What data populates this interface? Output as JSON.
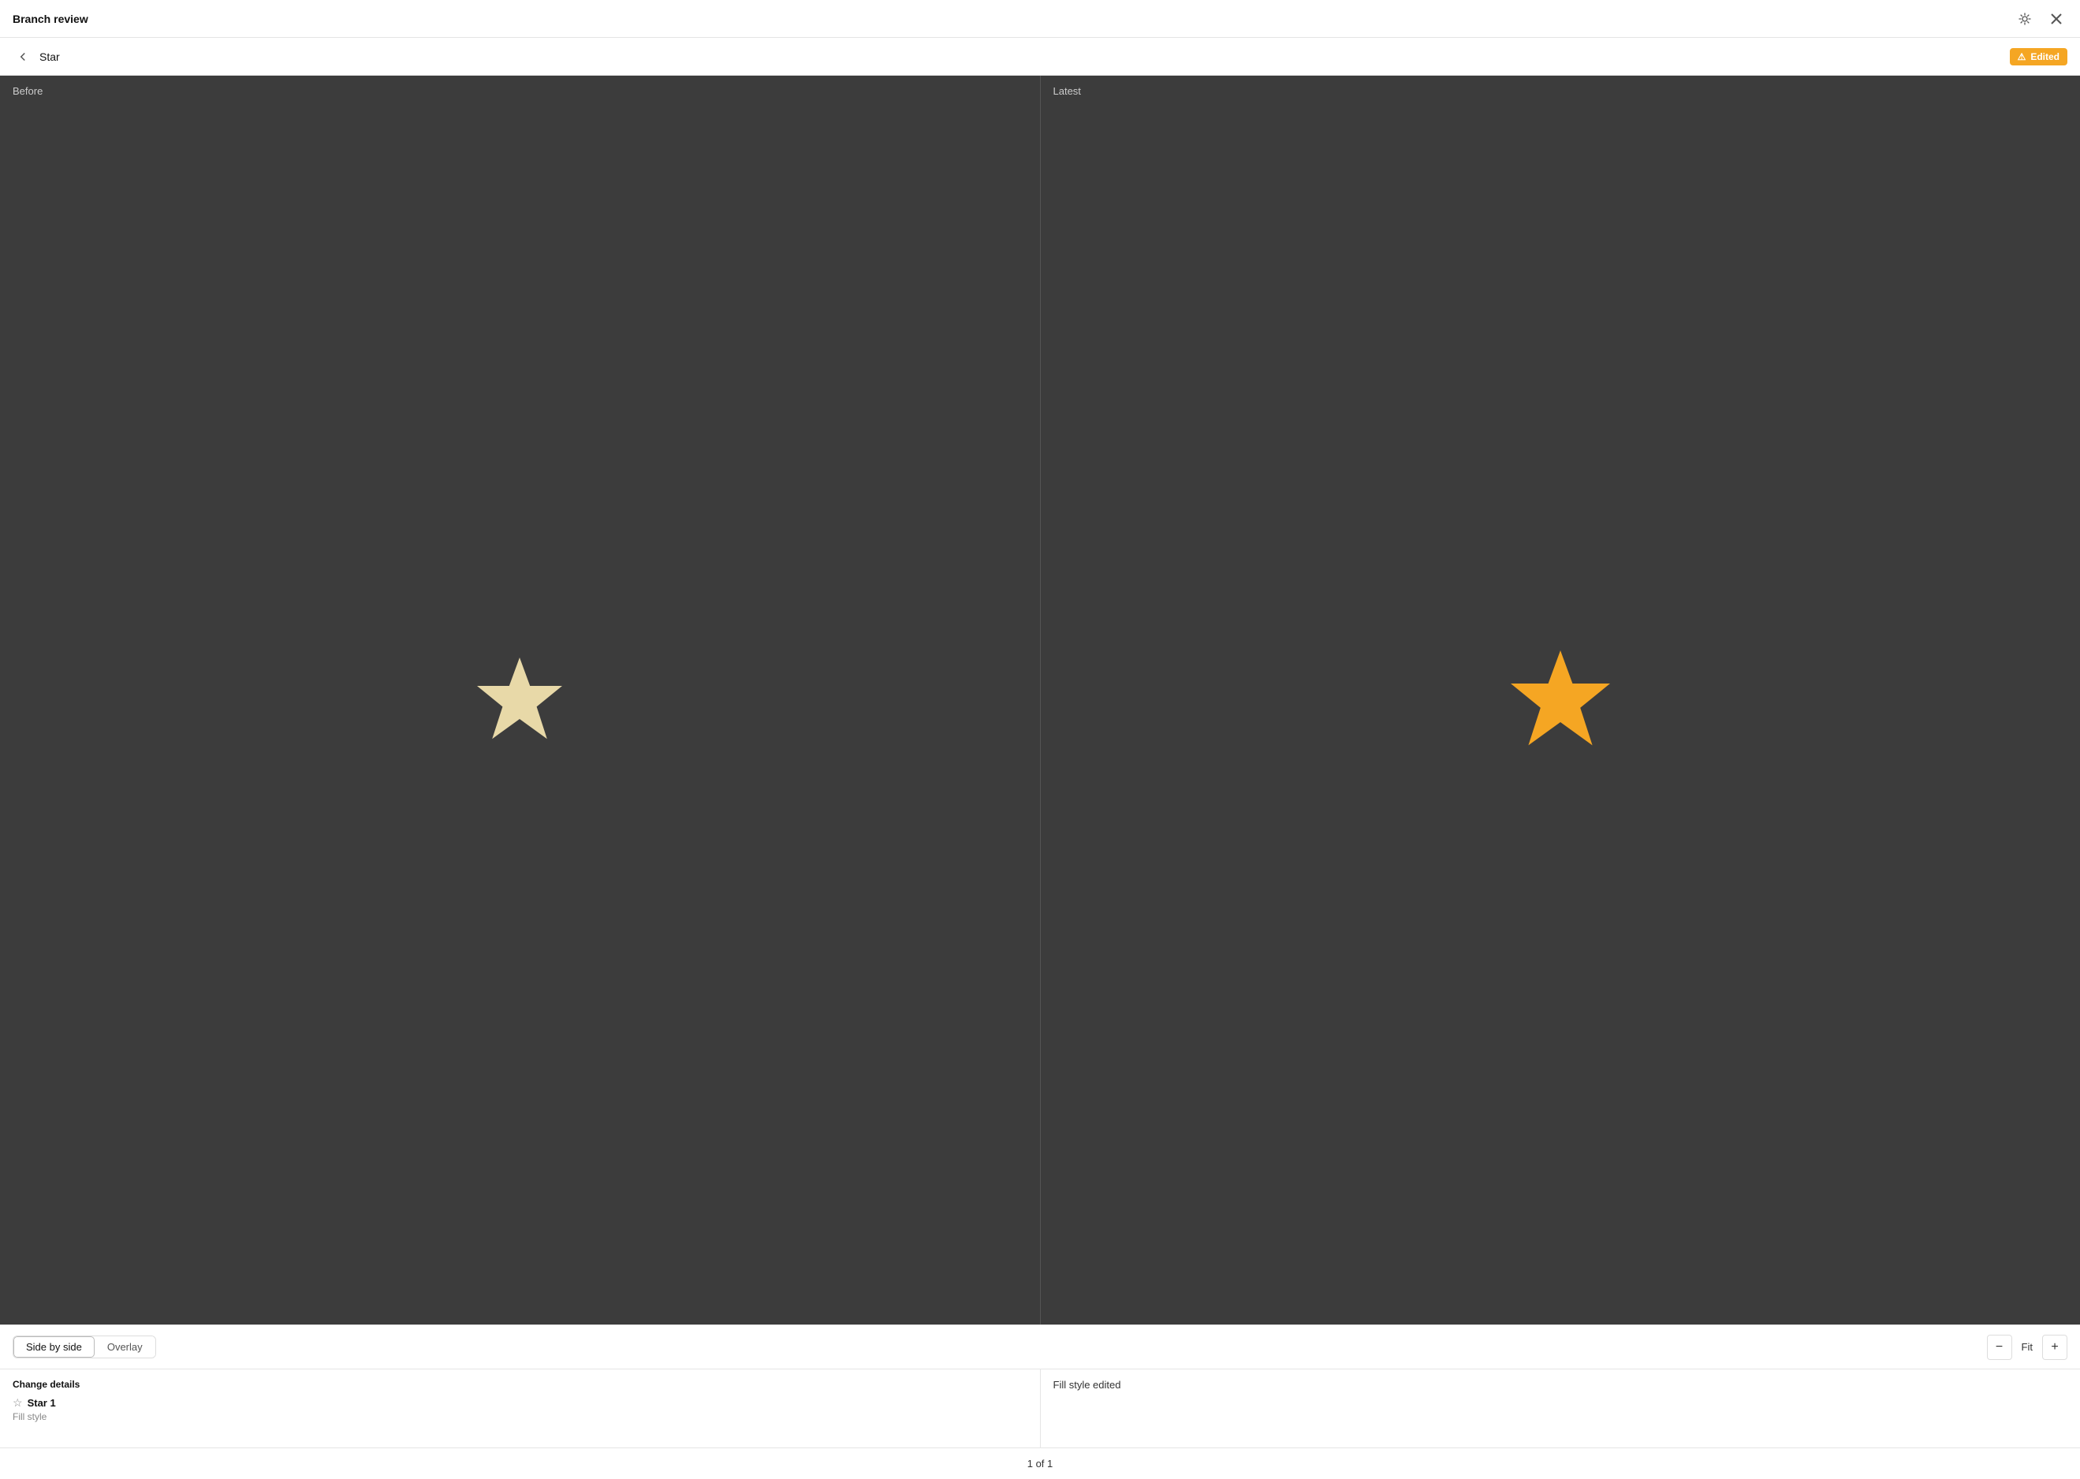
{
  "titleBar": {
    "title": "Branch review",
    "debugIconLabel": "debug-icon",
    "closeIconLabel": "close-icon"
  },
  "subHeader": {
    "backLabel": "back-arrow",
    "itemName": "Star",
    "badge": {
      "text": "Edited",
      "warnSymbol": "⚠"
    }
  },
  "panels": {
    "before": {
      "label": "Before"
    },
    "latest": {
      "label": "Latest"
    }
  },
  "bottomToolbar": {
    "viewOptions": [
      {
        "id": "side-by-side",
        "label": "Side by side",
        "active": true
      },
      {
        "id": "overlay",
        "label": "Overlay",
        "active": false
      }
    ],
    "zoom": {
      "decreaseLabel": "−",
      "fitLabel": "Fit",
      "increaseLabel": "+"
    }
  },
  "changeDetails": {
    "header": "Change details",
    "item": {
      "name": "Star 1",
      "subText": "Fill style"
    },
    "rightText": "Fill style edited"
  },
  "footer": {
    "text": "1 of 1"
  }
}
